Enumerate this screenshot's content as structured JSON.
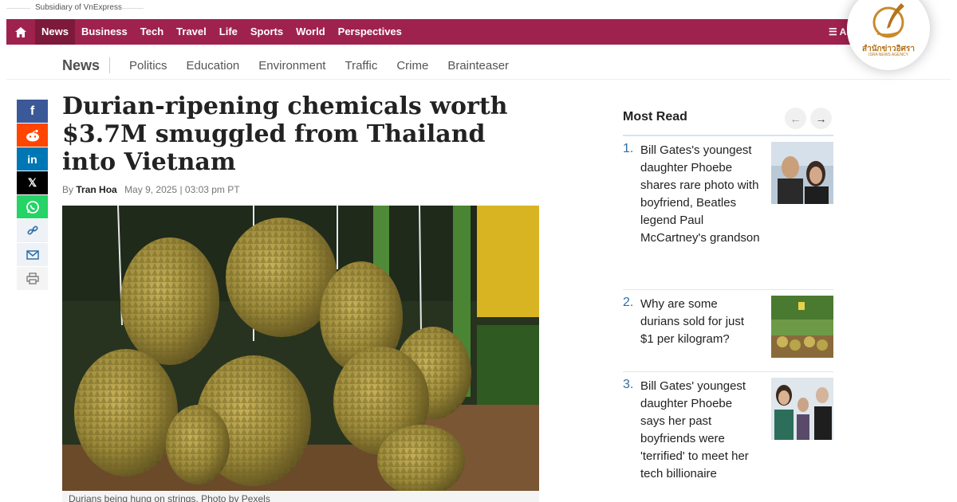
{
  "header": {
    "subsidiary": "Subsidiary of VnExpress"
  },
  "main_nav": {
    "home_icon": "home-icon",
    "items": [
      "News",
      "Business",
      "Tech",
      "Travel",
      "Life",
      "Sports",
      "World",
      "Perspectives"
    ],
    "active": "News",
    "all_label": "All",
    "brand_color": "#9f224e"
  },
  "sub_nav": {
    "section": "News",
    "items": [
      "Politics",
      "Education",
      "Environment",
      "Traffic",
      "Crime",
      "Brainteaser"
    ]
  },
  "share": [
    "facebook-icon",
    "reddit-icon",
    "linkedin-icon",
    "x-icon",
    "whatsapp-icon",
    "link-icon",
    "mail-icon",
    "print-icon"
  ],
  "article": {
    "headline": "Durian-ripening chemicals worth $3.7M smuggled from Thailand into Vietnam",
    "by": "By",
    "author": "Tran Hoa",
    "date": "May 9, 2025 | 03:03 pm PT",
    "caption": "Durians being hung on strings. Photo by Pexels"
  },
  "most_read": {
    "title": "Most Read",
    "items": [
      {
        "num": "1.",
        "title": "Bill Gates's youngest daughter Phoebe shares rare photo with boyfriend, Beatles legend Paul McCartney's grandson"
      },
      {
        "num": "2.",
        "title": "Why are some durians sold for just $1 per kilogram?"
      },
      {
        "num": "3.",
        "title": "Bill Gates' youngest daughter Phoebe says her past boyfriends were 'terrified' to meet her tech billionaire"
      }
    ]
  },
  "logo": {
    "name": "สำนักข่าวอิศรา",
    "sub": "ISRA NEWS AGENCY"
  }
}
